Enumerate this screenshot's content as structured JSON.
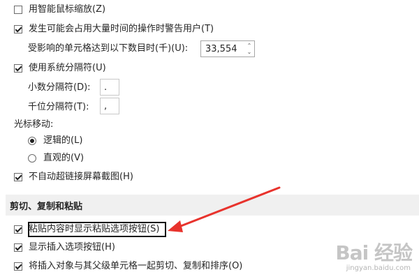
{
  "options": {
    "smart_mouse_zoom": {
      "label": "用智能鼠标缩放(Z)",
      "checked": false
    },
    "alert_long_ops": {
      "label": "发生可能会占用大量时间的操作时警告用户(T)",
      "checked": true
    },
    "affected_cells": {
      "label": "受影响的单元格达到以下数目时(千)(U):",
      "value": "33,554"
    },
    "use_system_separators": {
      "label": "使用系统分隔符(U)",
      "checked": true
    },
    "decimal_separator": {
      "label": "小数分隔符(D):",
      "value": "."
    },
    "thousands_separator": {
      "label": "千位分隔符(T):",
      "value": ","
    },
    "cursor_movement": {
      "label": "光标移动:",
      "logical": {
        "label": "逻辑的(L)",
        "checked": true
      },
      "visual": {
        "label": "直观的(V)",
        "checked": false
      }
    },
    "no_hyperlink_screenshot": {
      "label": "不自动超链接屏幕截图(H)",
      "checked": true
    }
  },
  "section_cut_copy_paste": {
    "title": "剪切、复制和粘贴",
    "show_paste_options": {
      "label": "粘贴内容时显示粘贴选项按钮(S)",
      "checked": true
    },
    "show_insert_options": {
      "label": "显示插入选项按钮(H)",
      "checked": true
    },
    "cut_copy_sort_objects": {
      "label": "将插入对象与其父级单元格一起剪切、复制和排序(O)",
      "checked": true
    }
  },
  "watermark": {
    "logo": "Bai 经验",
    "url": "jingyan.baidu.com"
  },
  "colors": {
    "annotation_arrow": "#e8332d",
    "section_band": "#f0f0f0"
  }
}
